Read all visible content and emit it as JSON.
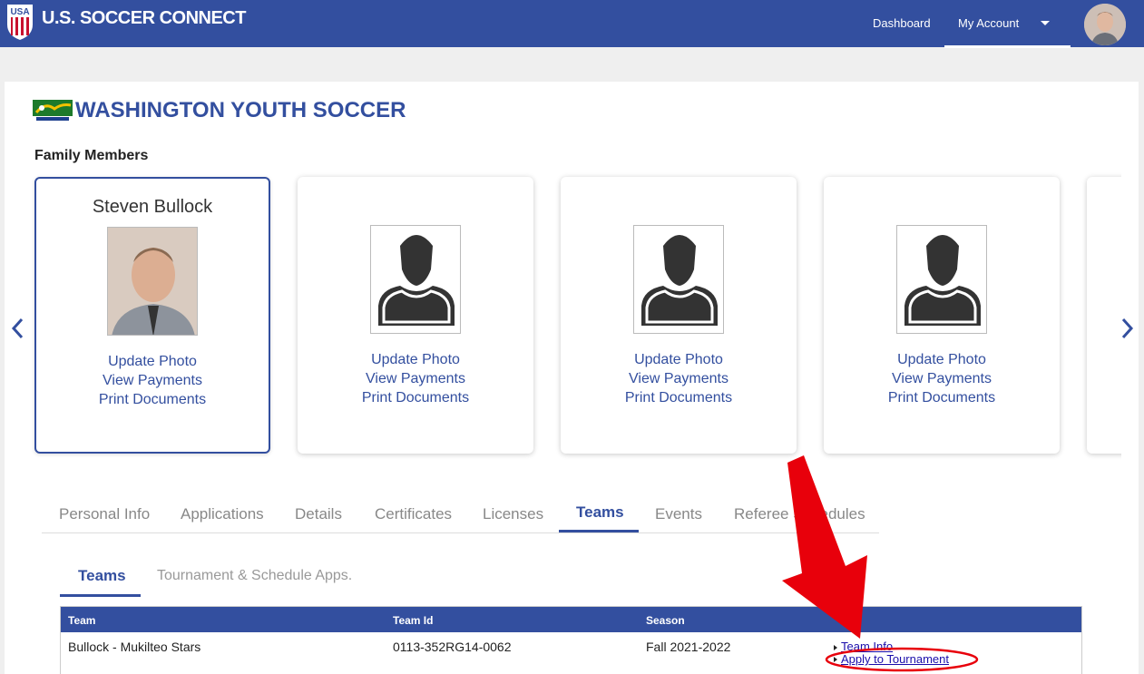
{
  "header": {
    "brand": "U.S. SOCCER CONNECT",
    "nav_dashboard": "Dashboard",
    "nav_account": "My Account",
    "bg_color": "#334f9f"
  },
  "org": {
    "title": "WASHINGTON YOUTH SOCCER"
  },
  "family": {
    "label": "Family Members",
    "members": [
      {
        "name": "Steven Bullock",
        "links": [
          "Update Photo",
          "View Payments",
          "Print Documents"
        ]
      },
      {
        "name": "",
        "links": [
          "Update Photo",
          "View Payments",
          "Print Documents"
        ]
      },
      {
        "name": "",
        "links": [
          "Update Photo",
          "View Payments",
          "Print Documents"
        ]
      },
      {
        "name": "",
        "links": [
          "Update Photo",
          "View Payments",
          "Print Documents"
        ]
      }
    ]
  },
  "tabs": [
    "Personal Info",
    "Applications",
    "Details",
    "Certificates",
    "Licenses",
    "Teams",
    "Events",
    "Referee Schedules"
  ],
  "active_tab": "Teams",
  "subtabs": [
    "Teams",
    "Tournament & Schedule Apps."
  ],
  "active_subtab": "Teams",
  "table": {
    "headers": [
      "Team",
      "Team Id",
      "Season",
      ""
    ],
    "rows": [
      {
        "team": "Bullock - Mukilteo Stars",
        "team_id": "0113-352RG14-0062",
        "season": "Fall 2021-2022",
        "actions": [
          "Team Info",
          "Apply to Tournament"
        ]
      }
    ]
  },
  "colors": {
    "accent": "#334f9f",
    "annotation": "#e8000b"
  }
}
